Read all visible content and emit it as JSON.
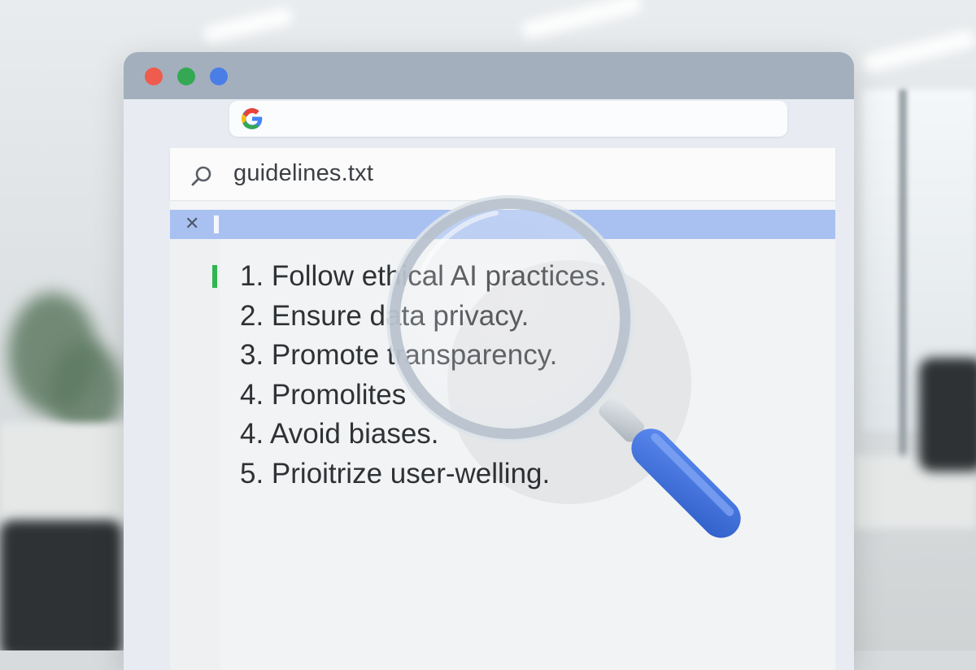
{
  "omnibox": {
    "logo_icon": "google-g-logo"
  },
  "search": {
    "query": "guidelines.txt",
    "icon": "search-icon"
  },
  "findbar": {
    "close_glyph": "✕"
  },
  "document": {
    "lines": [
      "1. Follow ethical AI practices.",
      "2. Ensure data privacy.",
      "3. Promote transparency.",
      "4. Promolites",
      "4. Avoid biases.",
      "5. Prioitrize user-welling."
    ]
  },
  "colors": {
    "titlebar": "#a3afbd",
    "dot_red": "#ef5b4c",
    "dot_green": "#34a853",
    "dot_blue": "#4a7ee6",
    "findbar": "#a9c1f1",
    "gutter_mark": "#2fb552",
    "magnifier_handle": "#3d6fd6"
  }
}
